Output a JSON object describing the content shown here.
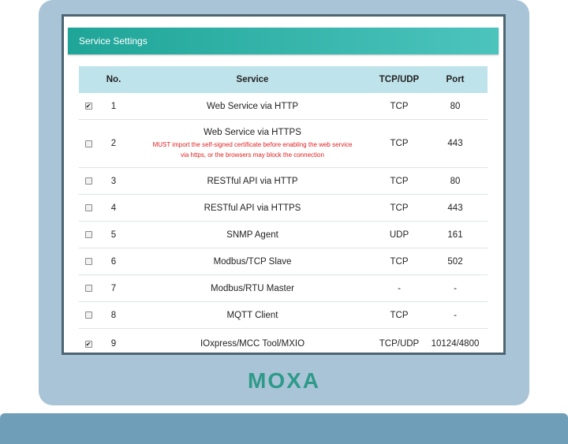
{
  "panel": {
    "title": "Service Settings"
  },
  "table": {
    "headers": {
      "no": "No.",
      "service": "Service",
      "protocol": "TCP/UDP",
      "port": "Port"
    },
    "rows": [
      {
        "checked": true,
        "no": "1",
        "service": "Web Service via HTTP",
        "protocol": "TCP",
        "port": "80"
      },
      {
        "checked": false,
        "no": "2",
        "service": "Web Service via HTTPS",
        "warning_line1": "MUST import the self-signed certificate before enabling the web service",
        "warning_line2": "via https, or the browsers may block the connection",
        "protocol": "TCP",
        "port": "443"
      },
      {
        "checked": false,
        "no": "3",
        "service": "RESTful API via HTTP",
        "protocol": "TCP",
        "port": "80"
      },
      {
        "checked": false,
        "no": "4",
        "service": "RESTful API via HTTPS",
        "protocol": "TCP",
        "port": "443"
      },
      {
        "checked": false,
        "no": "5",
        "service": "SNMP Agent",
        "protocol": "UDP",
        "port": "161"
      },
      {
        "checked": false,
        "no": "6",
        "service": "Modbus/TCP Slave",
        "protocol": "TCP",
        "port": "502"
      },
      {
        "checked": false,
        "no": "7",
        "service": "Modbus/RTU Master",
        "protocol": "-",
        "port": "-"
      },
      {
        "checked": false,
        "no": "8",
        "service": "MQTT Client",
        "protocol": "TCP",
        "port": "-"
      },
      {
        "checked": true,
        "no": "9",
        "service": "IOxpress/MCC Tool/MXIO",
        "protocol": "TCP/UDP",
        "port": "10124/4800"
      }
    ]
  },
  "brand": {
    "logo_text": "MOXA",
    "color": "#2e9a8a"
  },
  "colors": {
    "header_gradient_start": "#1fa598",
    "header_gradient_end": "#4cc4bd",
    "table_header_bg": "#bfe3ea",
    "warning": "#e02020"
  }
}
